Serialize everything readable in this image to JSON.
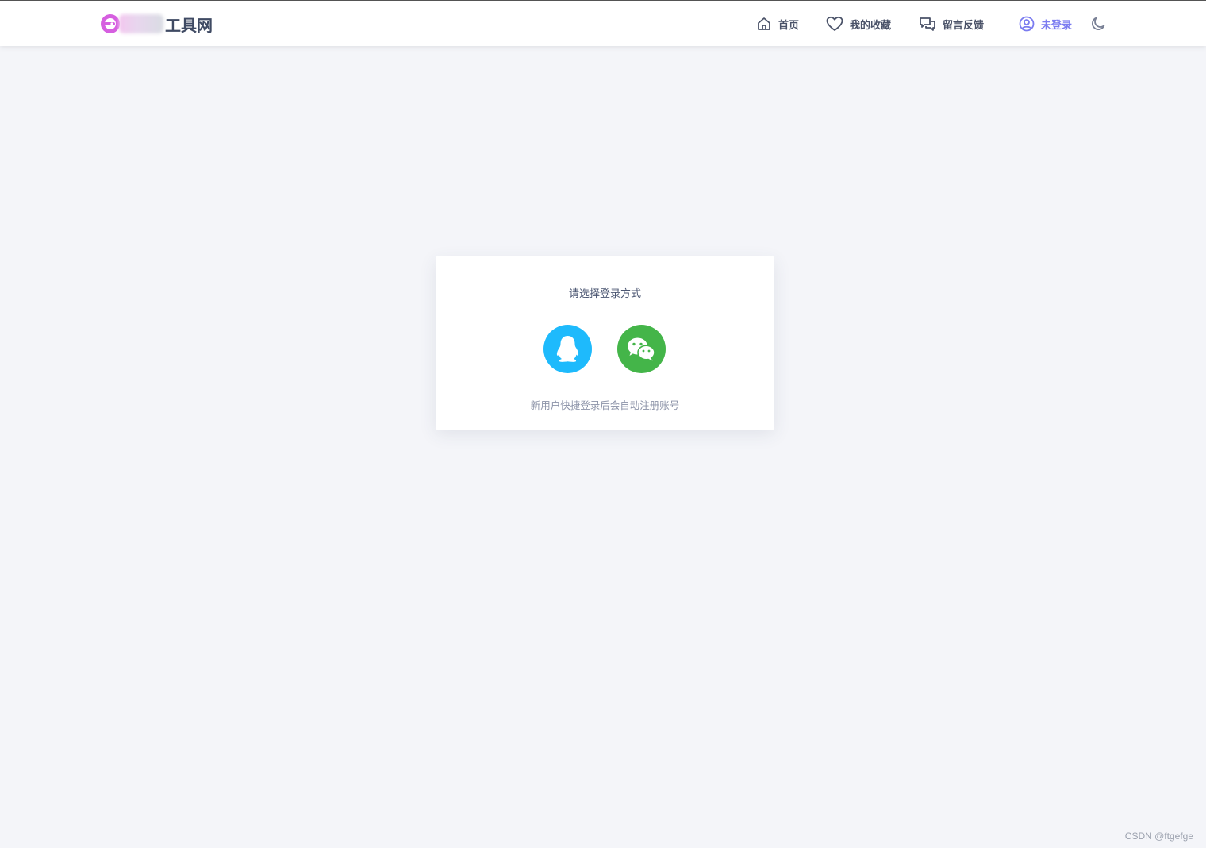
{
  "header": {
    "logo_text": "工具网",
    "nav": {
      "home_label": "首页",
      "favorites_label": "我的收藏",
      "feedback_label": "留言反馈",
      "login_label": "未登录"
    }
  },
  "login_card": {
    "title": "请选择登录方式",
    "note": "新用户快捷登录后会自动注册账号",
    "methods": {
      "qq_icon": "qq-penguin-icon",
      "wechat_icon": "wechat-icon"
    }
  },
  "colors": {
    "background": "#f4f5f9",
    "accent": "#7b7cf0",
    "qq": "#1ebafc",
    "wechat": "#44b549"
  },
  "watermark": "CSDN @ftgefge"
}
